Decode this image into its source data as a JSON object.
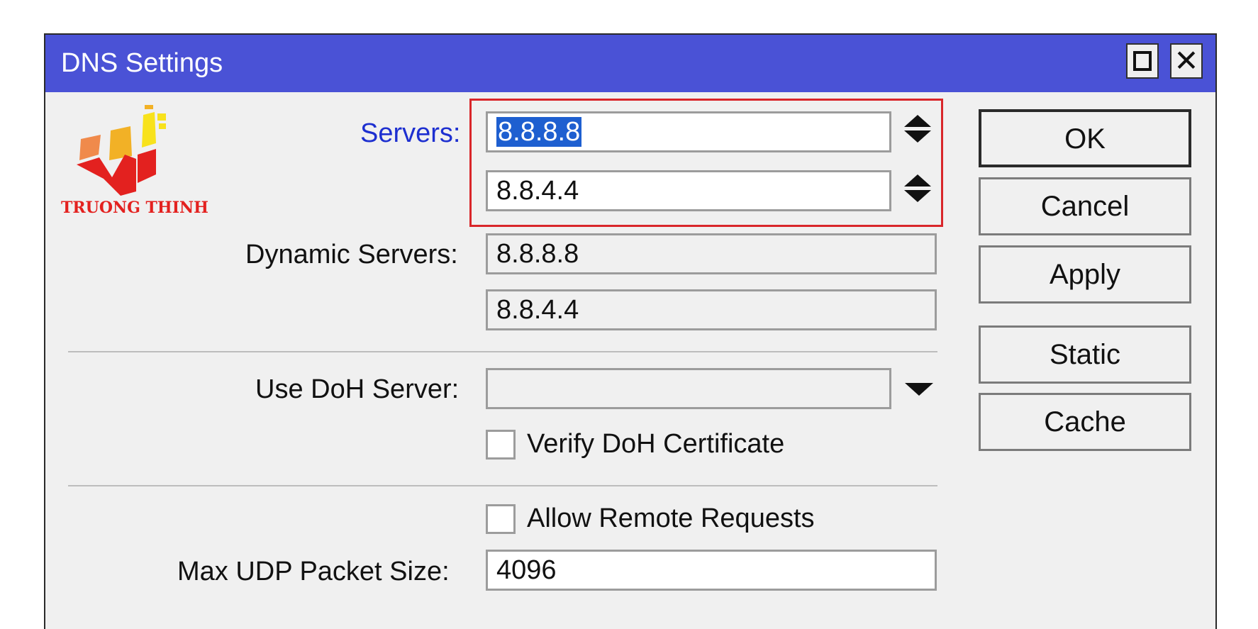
{
  "window": {
    "title": "DNS Settings",
    "maximize_label": "☐",
    "close_label": "✕"
  },
  "logo": {
    "text": "TRUONG THINH"
  },
  "form": {
    "servers_label": "Servers:",
    "servers": [
      "8.8.8.8",
      "8.8.4.4"
    ],
    "dynamic_servers_label": "Dynamic Servers:",
    "dynamic_servers": [
      "8.8.8.8",
      "8.8.4.4"
    ],
    "use_doh_label": "Use DoH Server:",
    "use_doh_value": "",
    "verify_doh_label": "Verify DoH Certificate",
    "verify_doh_checked": false,
    "allow_remote_label": "Allow Remote Requests",
    "allow_remote_checked": false,
    "max_udp_label": "Max UDP Packet Size:",
    "max_udp_value": "4096"
  },
  "buttons": {
    "ok": "OK",
    "cancel": "Cancel",
    "apply": "Apply",
    "static": "Static",
    "cache": "Cache"
  },
  "colors": {
    "titlebar": "#4a52d6",
    "highlight_box": "#d9262a",
    "selection": "#1e5fd0",
    "label_focus": "#1d2fd0"
  }
}
